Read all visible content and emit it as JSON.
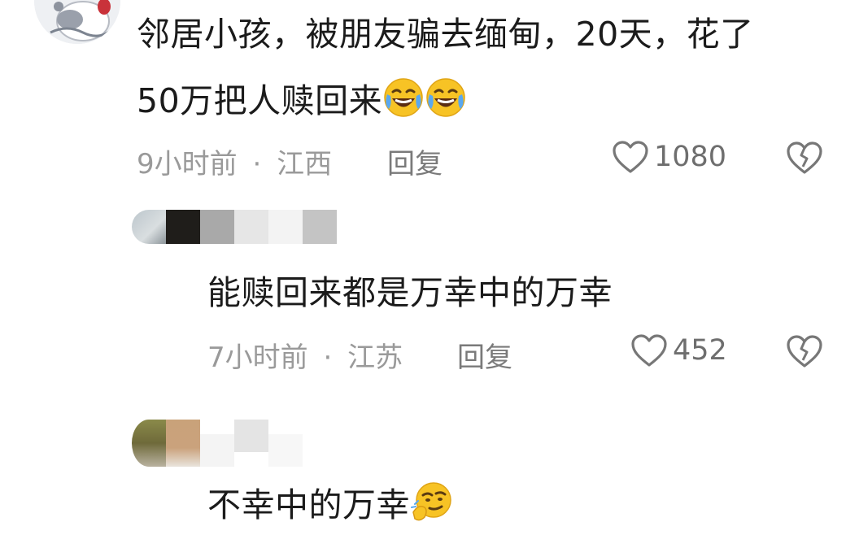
{
  "comments": [
    {
      "text_line1": "邻居小孩，被朋友骗去缅甸，20天，花了",
      "text_line2": "50万把人赎回来",
      "emojis": [
        "laughing-crying-emoji",
        "laughing-crying-emoji"
      ],
      "time": "9小时前",
      "location": "江西",
      "separator": "·",
      "reply_label": "回复",
      "likes": "1080"
    },
    {
      "text": "能赎回来都是万幸中的万幸",
      "time": "7小时前",
      "location": "江苏",
      "separator": "·",
      "reply_label": "回复",
      "likes": "452"
    },
    {
      "text": "不幸中的万幸",
      "emojis": [
        "smug-thinking-emoji"
      ]
    }
  ],
  "colors": {
    "text": "#1b1b1b",
    "meta": "#9a9a9a",
    "icon": "#777777"
  }
}
